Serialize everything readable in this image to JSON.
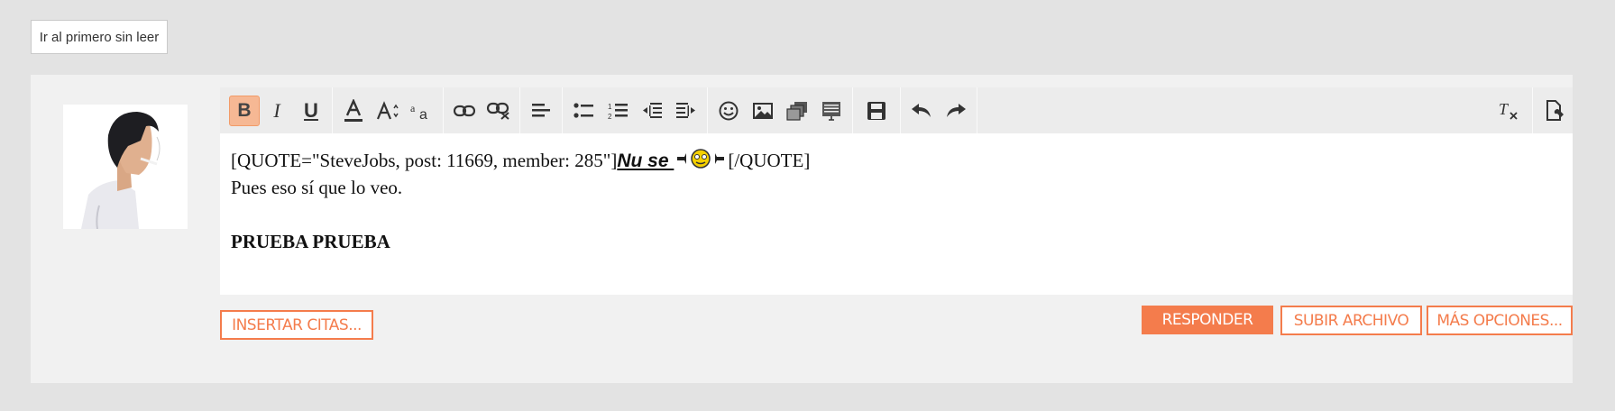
{
  "top": {
    "first_unread_label": "Ir al primero sin leer"
  },
  "editor": {
    "content": {
      "quote_prefix": "[QUOTE=\"SteveJobs, post: 11669, member: 285\"]",
      "quote_text": "Nu se ",
      "quote_suffix": "[/QUOTE]",
      "line2": "Pues eso sí que lo veo.",
      "line4": "PRUEBA PRUEBA"
    }
  },
  "actions": {
    "insert_quotes": "INSERTAR CITAS...",
    "reply": "RESPONDER",
    "upload": "SUBIR ARCHIVO",
    "more_options": "MÁS OPCIONES..."
  },
  "colors": {
    "accent": "#f47c4c",
    "bold_active_bg": "#f6b894"
  },
  "icons": [
    "bold-icon",
    "italic-icon",
    "underline-icon",
    "text-color-icon",
    "font-size-icon",
    "font-family-icon",
    "link-icon",
    "unlink-icon",
    "align-icon",
    "bullet-list-icon",
    "numbered-list-icon",
    "outdent-icon",
    "indent-icon",
    "smilie-icon",
    "image-icon",
    "media-icon",
    "insert-icon",
    "save-draft-icon",
    "undo-icon",
    "redo-icon",
    "remove-format-icon",
    "toggle-bbcode-icon"
  ]
}
